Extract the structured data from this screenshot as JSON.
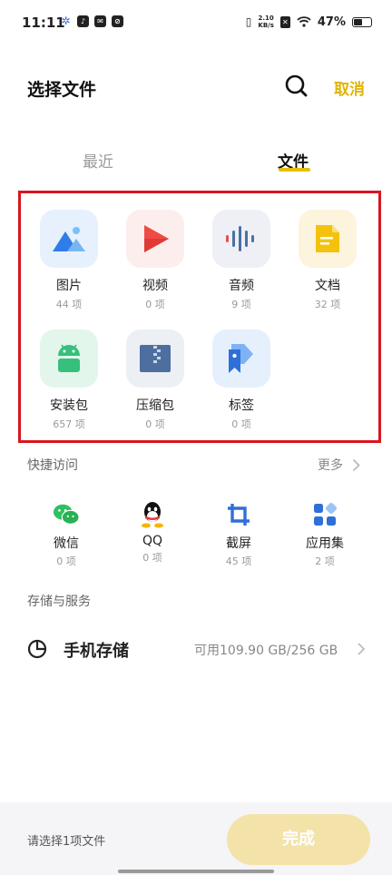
{
  "status_bar": {
    "time": "11:11",
    "net_speed_value": "2.10",
    "net_speed_unit": "KB/s",
    "battery_percent": "47%"
  },
  "header": {
    "title": "选择文件",
    "cancel_label": "取消"
  },
  "tabs": [
    {
      "label": "最近",
      "active": false
    },
    {
      "label": "文件",
      "active": true
    }
  ],
  "categories": [
    {
      "label": "图片",
      "count": "44 项",
      "icon": "image-icon"
    },
    {
      "label": "视频",
      "count": "0 项",
      "icon": "video-icon"
    },
    {
      "label": "音频",
      "count": "9 项",
      "icon": "audio-icon"
    },
    {
      "label": "文档",
      "count": "32 项",
      "icon": "document-icon"
    },
    {
      "label": "安装包",
      "count": "657 项",
      "icon": "android-icon"
    },
    {
      "label": "压缩包",
      "count": "0 项",
      "icon": "archive-icon"
    },
    {
      "label": "标签",
      "count": "0 项",
      "icon": "tag-icon"
    }
  ],
  "quick_access": {
    "title": "快捷访问",
    "more_label": "更多",
    "items": [
      {
        "label": "微信",
        "count": "0 项",
        "icon": "wechat-icon"
      },
      {
        "label": "QQ",
        "count": "0 项",
        "icon": "qq-icon"
      },
      {
        "label": "截屏",
        "count": "45 项",
        "icon": "crop-icon"
      },
      {
        "label": "应用集",
        "count": "2 项",
        "icon": "apps-icon"
      }
    ]
  },
  "storage": {
    "title": "存储与服务",
    "label": "手机存储",
    "value": "可用109.90 GB/256 GB"
  },
  "bottom": {
    "selection_text": "请选择1项文件",
    "done_label": "完成"
  },
  "colors": {
    "accent": "#e8bf00",
    "highlight_border": "#d9161f",
    "done_disabled": "#f3e3a9"
  }
}
